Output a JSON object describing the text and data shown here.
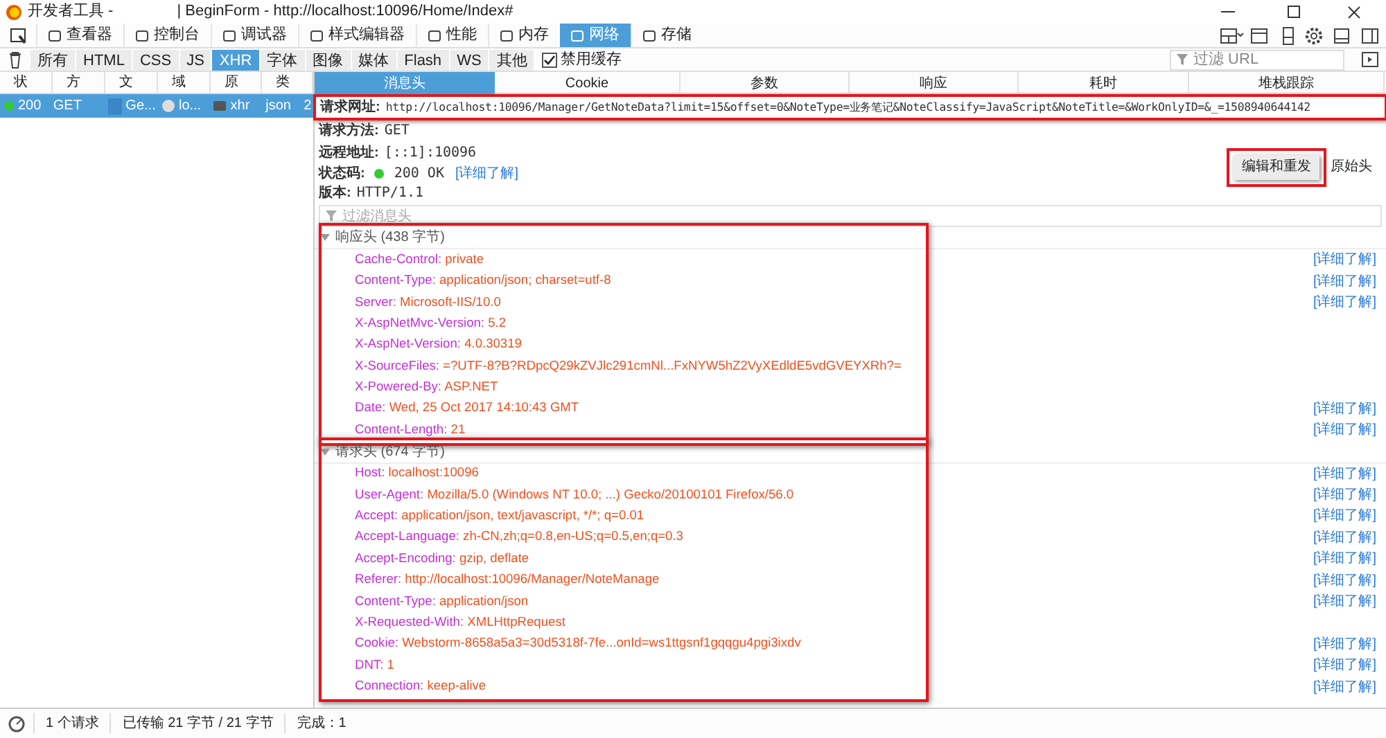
{
  "window": {
    "title_left": "开发者工具 -",
    "title_right": "| BeginForm - http://localhost:10096/Home/Index#"
  },
  "tools": [
    {
      "label": "查看器",
      "selected": false
    },
    {
      "label": "控制台",
      "selected": false
    },
    {
      "label": "调试器",
      "selected": false
    },
    {
      "label": "样式编辑器",
      "selected": false
    },
    {
      "label": "性能",
      "selected": false
    },
    {
      "label": "内存",
      "selected": false
    },
    {
      "label": "网络",
      "selected": true
    },
    {
      "label": "存储",
      "selected": false
    }
  ],
  "filters": [
    {
      "label": "所有",
      "selected": false
    },
    {
      "label": "HTML",
      "selected": false
    },
    {
      "label": "CSS",
      "selected": false
    },
    {
      "label": "JS",
      "selected": false
    },
    {
      "label": "XHR",
      "selected": true
    },
    {
      "label": "字体",
      "selected": false
    },
    {
      "label": "图像",
      "selected": false
    },
    {
      "label": "媒体",
      "selected": false
    },
    {
      "label": "Flash",
      "selected": false
    },
    {
      "label": "WS",
      "selected": false
    },
    {
      "label": "其他",
      "selected": false
    }
  ],
  "disable_cache": {
    "label": "禁用缓存",
    "checked": true
  },
  "url_filter": {
    "placeholder": "过滤 URL"
  },
  "request_list": {
    "columns": [
      "状",
      "方",
      "文",
      "域",
      "原",
      "类"
    ],
    "rows": [
      {
        "selected": true,
        "cells": [
          "200",
          "GET",
          "Ge...",
          "lo...",
          "xhr",
          "json",
          "2"
        ]
      }
    ]
  },
  "detail_tabs": [
    {
      "label": "消息头",
      "selected": true
    },
    {
      "label": "Cookie",
      "selected": false
    },
    {
      "label": "参数",
      "selected": false
    },
    {
      "label": "响应",
      "selected": false
    },
    {
      "label": "耗时",
      "selected": false
    },
    {
      "label": "堆栈跟踪",
      "selected": false
    }
  ],
  "summary": [
    {
      "label": "请求网址:",
      "value": "http://localhost:10096/Manager/GetNoteData?limit=15&offset=0&NoteType=业务笔记&NoteClassify=JavaScript&NoteTitle=&WorkOnlyID=&_=1508940644142",
      "highlighted": true
    },
    {
      "label": "请求方法:",
      "value": "GET",
      "highlighted": false
    },
    {
      "label": "远程地址:",
      "value": "[::1]:10096",
      "highlighted": false
    },
    {
      "label": "状态码:",
      "value": "200 OK",
      "link": "[详细了解]",
      "kind": "status",
      "highlighted": false
    },
    {
      "label": "版本:",
      "value": "HTTP/1.1",
      "highlighted": false
    }
  ],
  "actions": [
    {
      "label": "编辑和重发",
      "highlighted": true
    },
    {
      "label": "原始头",
      "highlighted": false
    }
  ],
  "header_filter": {
    "placeholder": "过滤消息头"
  },
  "sections": [
    {
      "title": "响应头 (438 字节)",
      "expanded": true,
      "highlighted": true,
      "headers": [
        {
          "name": "Cache-Control:",
          "value": "private",
          "link": "[详细了解]"
        },
        {
          "name": "Content-Type:",
          "value": "application/json; charset=utf-8",
          "link": "[详细了解]"
        },
        {
          "name": "Server:",
          "value": "Microsoft-IIS/10.0",
          "link": "[详细了解]"
        },
        {
          "name": "X-AspNetMvc-Version:",
          "value": "5.2"
        },
        {
          "name": "X-AspNet-Version:",
          "value": "4.0.30319"
        },
        {
          "name": "X-SourceFiles:",
          "value": "=?UTF-8?B?RDpcQ29kZVJlc291cmNl...FxNYW5hZ2VyXEdldE5vdGVEYXRh?="
        },
        {
          "name": "X-Powered-By:",
          "value": "ASP.NET"
        },
        {
          "name": "Date:",
          "value": "Wed, 25 Oct 2017 14:10:43 GMT",
          "link": "[详细了解]"
        },
        {
          "name": "Content-Length:",
          "value": "21",
          "link": "[详细了解]"
        }
      ]
    },
    {
      "title": "请求头 (674 字节)",
      "expanded": true,
      "highlighted": true,
      "headers": [
        {
          "name": "Host:",
          "value": "localhost:10096",
          "link": "[详细了解]"
        },
        {
          "name": "User-Agent:",
          "value": "Mozilla/5.0 (Windows NT 10.0; ...) Gecko/20100101 Firefox/56.0",
          "link": "[详细了解]"
        },
        {
          "name": "Accept:",
          "value": "application/json, text/javascript, */*; q=0.01",
          "link": "[详细了解]"
        },
        {
          "name": "Accept-Language:",
          "value": "zh-CN,zh;q=0.8,en-US;q=0.5,en;q=0.3",
          "link": "[详细了解]"
        },
        {
          "name": "Accept-Encoding:",
          "value": "gzip, deflate",
          "link": "[详细了解]"
        },
        {
          "name": "Referer:",
          "value": "http://localhost:10096/Manager/NoteManage",
          "link": "[详细了解]"
        },
        {
          "name": "Content-Type:",
          "value": "application/json",
          "link": "[详细了解]"
        },
        {
          "name": "X-Requested-With:",
          "value": "XMLHttpRequest"
        },
        {
          "name": "Cookie:",
          "value": "Webstorm-8658a5a3=30d5318f-7fe...onId=ws1ttgsnf1gqqgu4pgi3ixdv",
          "link": "[详细了解]"
        },
        {
          "name": "DNT:",
          "value": "1",
          "link": "[详细了解]"
        },
        {
          "name": "Connection:",
          "value": "keep-alive",
          "link": "[详细了解]"
        }
      ]
    }
  ],
  "status_bar": [
    "1 个请求",
    "已传输 21 字节 / 21 字节",
    "完成：1"
  ]
}
